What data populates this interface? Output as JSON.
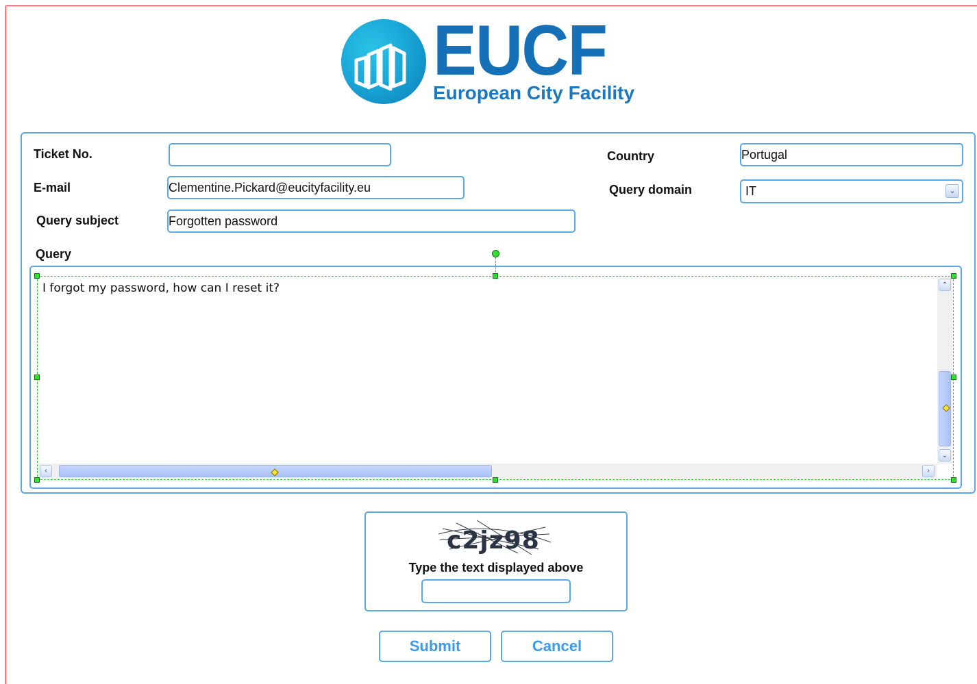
{
  "logo": {
    "name": "EUCF",
    "subtitle": "European City Facility"
  },
  "form": {
    "ticket_no": {
      "label": "Ticket No.",
      "value": ""
    },
    "email": {
      "label": "E-mail",
      "value": "Clementine.Pickard@eucityfacility.eu"
    },
    "query_subject": {
      "label": "Query subject",
      "value": "Forgotten password"
    },
    "country": {
      "label": "Country",
      "value": "Portugal"
    },
    "query_domain": {
      "label": "Query domain",
      "value": "IT"
    },
    "query": {
      "label": "Query",
      "value": "I forgot my password, how can I reset it?"
    }
  },
  "captcha": {
    "image_text": "c2jz98",
    "label": "Type the text displayed above",
    "value": ""
  },
  "buttons": {
    "submit": "Submit",
    "cancel": "Cancel"
  },
  "colors": {
    "border": "#5aa8e8",
    "button_text": "#3d9ae8",
    "logo_blue": "#1670b8",
    "frame_red": "#e02020"
  }
}
